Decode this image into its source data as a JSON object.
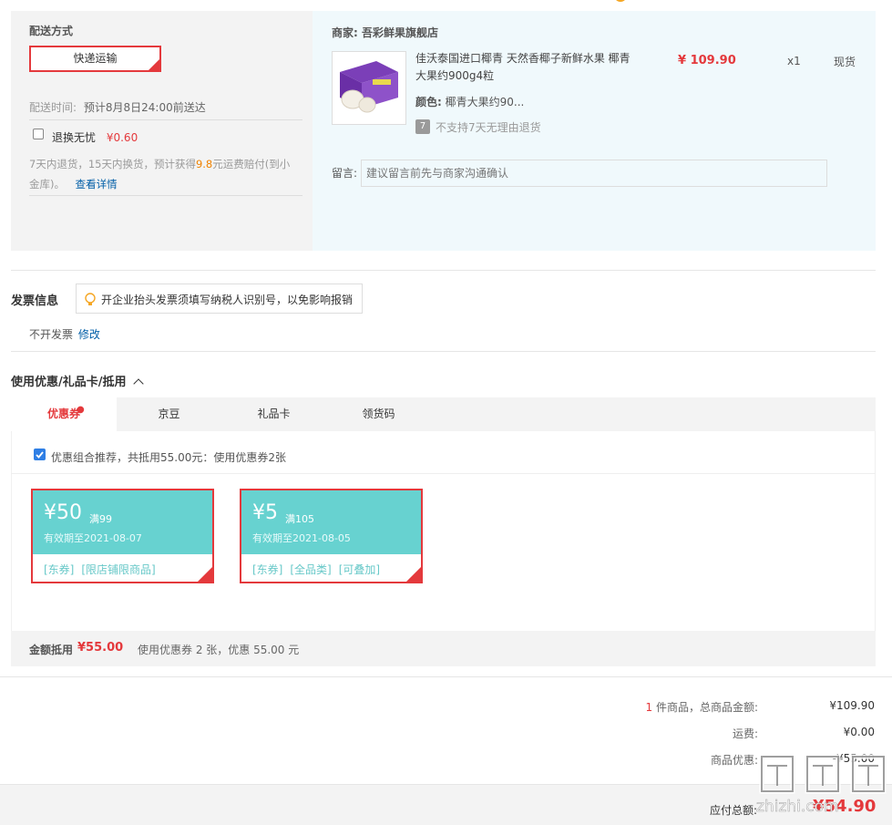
{
  "shipping": {
    "title": "配送方式",
    "method_label": "快递运输",
    "time_label": "配送时间:",
    "time_value": "预计8月8日24:00前送达",
    "insurance_label": "退换无忧",
    "insurance_price": "¥0.60",
    "insurance_desc_1": "7天内退货，15天内换货，预计获得",
    "insurance_desc_highlight": "9.8",
    "insurance_desc_2": "元运费赔付(到小",
    "insurance_desc_3": "金库)。",
    "insurance_link": "查看详情"
  },
  "merchant": {
    "label": "商家:",
    "name": "吾彩鲜果旗舰店",
    "product_title_line1": "佳沃泰国进口椰青 天然香椰子新鲜水果 椰青",
    "product_title_line2": "大果约900g4粒",
    "price": "¥ 109.90",
    "qty": "x1",
    "stock": "现货",
    "color_label": "颜色:",
    "color_value": "椰青大果约90...",
    "no_return_badge": "7",
    "no_return_text": "不支持7天无理由退货",
    "message_label": "留言:",
    "message_placeholder": "建议留言前先与商家沟通确认"
  },
  "invoice": {
    "title": "发票信息",
    "tip": "开企业抬头发票须填写纳税人识别号，以免影响报销",
    "status": "不开发票",
    "edit": "修改"
  },
  "discount": {
    "title": "使用优惠/礼品卡/抵用",
    "tabs": [
      {
        "label": "优惠券"
      },
      {
        "label": "京豆"
      },
      {
        "label": "礼品卡"
      },
      {
        "label": "领货码"
      }
    ],
    "combo_text": "优惠组合推荐，共抵用55.00元：使用优惠券2张",
    "coupons": [
      {
        "amount": "¥50",
        "cond": "满99",
        "expiry": "有效期至2021-08-07",
        "tags": [
          "[东券]",
          "[限店铺限商品]"
        ]
      },
      {
        "amount": "¥5",
        "cond": "满105",
        "expiry": "有效期至2021-08-05",
        "tags": [
          "[东券]",
          "[全品类]",
          "[可叠加]"
        ]
      }
    ],
    "summary_label": "金额抵用",
    "summary_amount": "¥55.00",
    "summary_desc": "使用优惠券 2 张，优惠 55.00 元"
  },
  "totals": {
    "count": "1",
    "count_label": "件商品，总商品金额:",
    "goods_amount": "¥109.90",
    "freight_label": "运费:",
    "freight": "¥0.00",
    "discount_label": "商品优惠:",
    "discount": "-¥55.00",
    "payable_label": "应付总额:",
    "payable": "¥54.90"
  },
  "watermark": "值 什么值得买 zhizhi.com"
}
